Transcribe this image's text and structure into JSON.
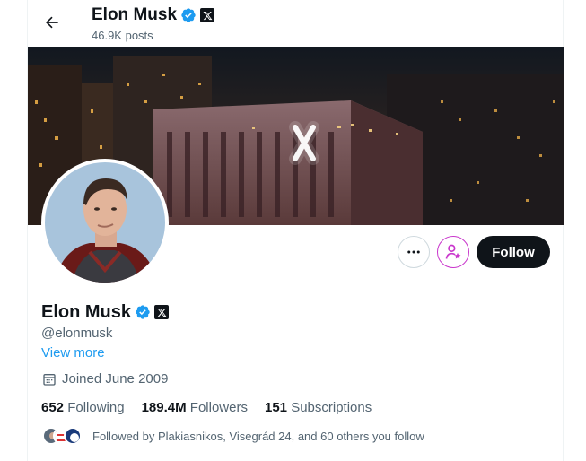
{
  "header": {
    "name": "Elon Musk",
    "posts": "46.9K posts"
  },
  "profile": {
    "name": "Elon Musk",
    "handle": "@elonmusk",
    "view_more": "View more",
    "joined": "Joined June 2009",
    "follow_label": "Follow",
    "more_label": "•••"
  },
  "stats": {
    "following_count": "652",
    "following_label": "Following",
    "followers_count": "189.4M",
    "followers_label": "Followers",
    "subscriptions_count": "151",
    "subscriptions_label": "Subscriptions"
  },
  "followed_by": "Followed by Plakiasnikos, Visegrád 24, and 60 others you follow",
  "colors": {
    "verified": "#1d9bf0",
    "subscribe_accent": "#c936cc",
    "follow_bg": "#0f1419",
    "link": "#1d9bf0"
  }
}
